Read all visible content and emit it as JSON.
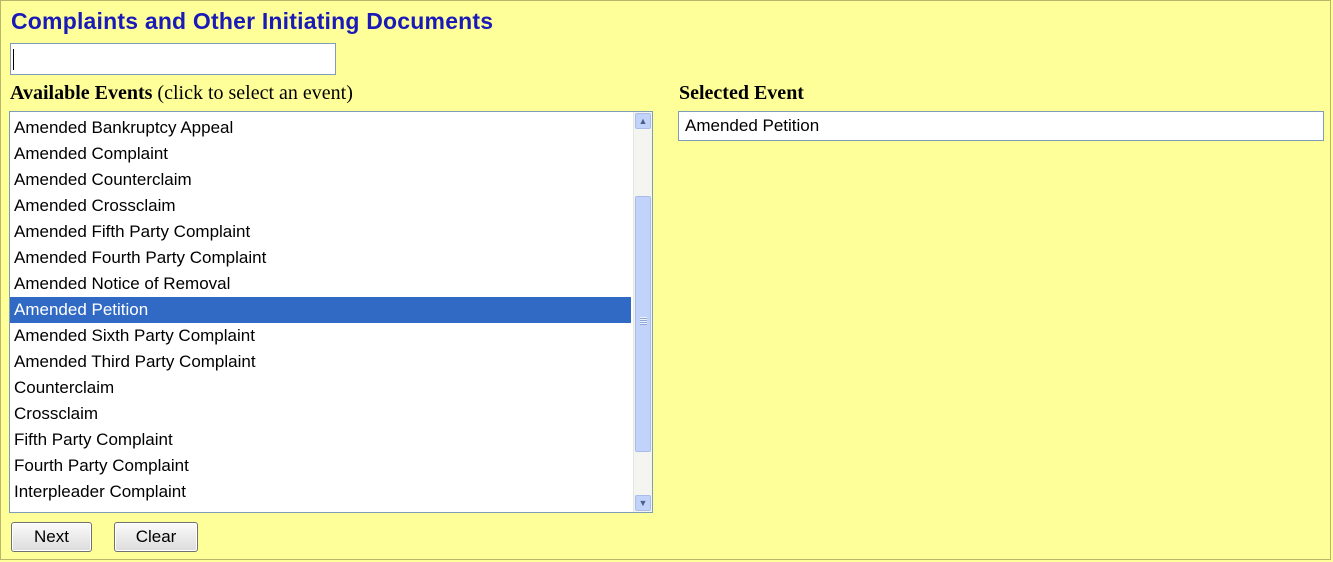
{
  "header": {
    "title": "Complaints and Other Initiating Documents"
  },
  "search": {
    "value": "",
    "placeholder": ""
  },
  "available_events": {
    "label_bold": "Available Events",
    "label_hint": " (click to select an event)",
    "items": [
      "Amended Bankruptcy Appeal",
      "Amended Complaint",
      "Amended Counterclaim",
      "Amended Crossclaim",
      "Amended Fifth Party Complaint",
      "Amended Fourth Party Complaint",
      "Amended Notice of Removal",
      "Amended Petition",
      "Amended Sixth Party Complaint",
      "Amended Third Party Complaint",
      "Counterclaim",
      "Crossclaim",
      "Fifth Party Complaint",
      "Fourth Party Complaint",
      "Interpleader Complaint"
    ],
    "selected_index": 7
  },
  "selected_event": {
    "label": "Selected Event",
    "value": "Amended Petition"
  },
  "buttons": {
    "next": "Next",
    "clear": "Clear"
  },
  "colors": {
    "background": "#ffff99",
    "title": "#1a1ab8",
    "selection": "#316ac5"
  },
  "icons": {
    "scroll_up": "arrow-up-icon",
    "scroll_down": "arrow-down-icon"
  }
}
